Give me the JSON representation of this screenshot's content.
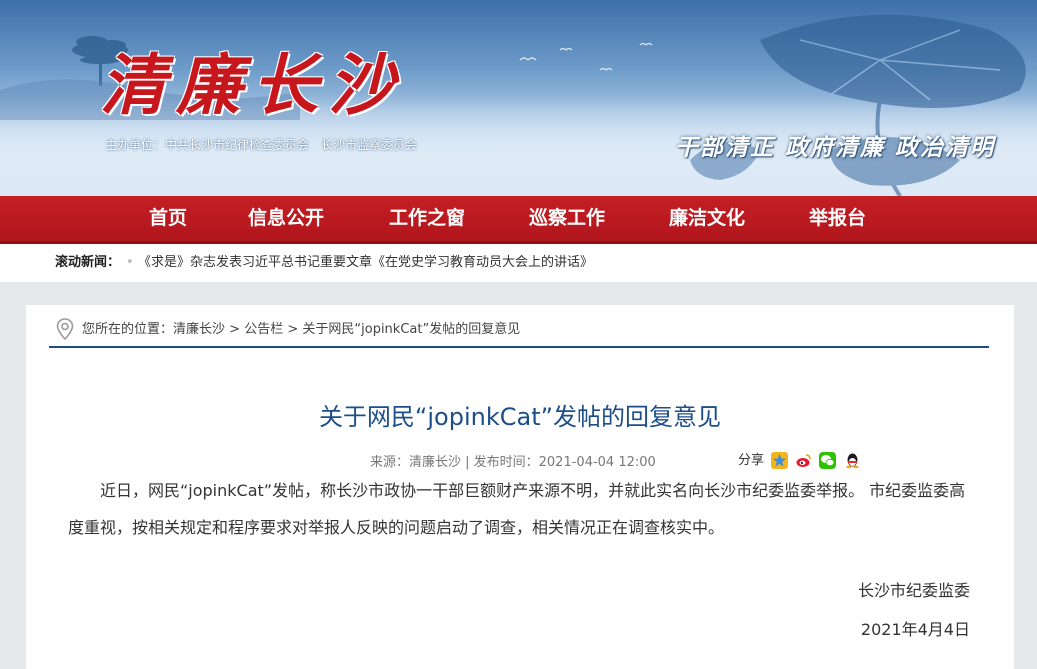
{
  "banner": {
    "site_title": "清廉长沙",
    "host_line": "主办单位：中共长沙市纪律检查委员会　长沙市监察委员会",
    "slogan": "干部清正  政府清廉  政治清明"
  },
  "nav": {
    "items": [
      "首页",
      "信息公开",
      "工作之窗",
      "巡察工作",
      "廉洁文化",
      "举报台"
    ]
  },
  "ticker": {
    "label": "滚动新闻：",
    "text": "《求是》杂志发表习近平总书记重要文章《在党史学习教育动员大会上的讲话》"
  },
  "breadcrumb": {
    "prefix": "您所在的位置：",
    "home": "清廉长沙",
    "sep": " > ",
    "section": "公告栏",
    "current": "关于网民“jopinkCat”发帖的回复意见"
  },
  "article": {
    "title": "关于网民“jopinkCat”发帖的回复意见",
    "meta": "来源：清廉长沙 | 发布时间：2021-04-04 12:00",
    "share_label": "分享",
    "share_icons": [
      "qzone-icon",
      "weibo-icon",
      "wechat-icon",
      "qq-icon"
    ],
    "body": "近日，网民“jopinkCat”发帖，称长沙市政协一干部巨额财产来源不明，并就此实名向长沙市纪委监委举报。 市纪委监委高度重视，按相关规定和程序要求对举报人反映的问题启动了调查，相关情况正在调查核实中。",
    "signature_org": "长沙市纪委监委",
    "signature_date": "2021年4月4日"
  },
  "colors": {
    "brand_red": "#c41f25",
    "title_blue": "#1d4e8a",
    "page_bg": "#e6e8eb"
  }
}
